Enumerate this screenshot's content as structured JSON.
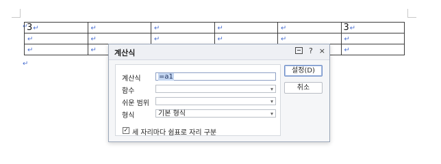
{
  "document": {
    "table": {
      "rows": [
        [
          "3",
          "",
          "",
          "",
          "",
          "3"
        ],
        [
          "",
          "",
          "",
          "",
          "",
          ""
        ],
        [
          "",
          "",
          "",
          "",
          "",
          ""
        ]
      ]
    },
    "para_mark": "↵"
  },
  "dialog": {
    "title": "계산식",
    "tools": {
      "help": "?",
      "close": "×"
    },
    "fields": {
      "formula": {
        "label": "계산식",
        "value": "=a1"
      },
      "function": {
        "label": "함수",
        "value": ""
      },
      "range": {
        "label": "쉬운 범위",
        "value": ""
      },
      "format": {
        "label": "형식",
        "value": "기본 형식"
      }
    },
    "checkbox": {
      "label": "세 자리마다 쉼표로 자리 구분",
      "checked": true,
      "mark": "✓"
    },
    "buttons": {
      "ok": "설정(D)",
      "cancel": "취소"
    },
    "caret": "▾"
  },
  "colors": {
    "para_mark": "#4a6fd0",
    "selection": "#c5d7f2",
    "dialog_border": "#9aa6b8"
  }
}
